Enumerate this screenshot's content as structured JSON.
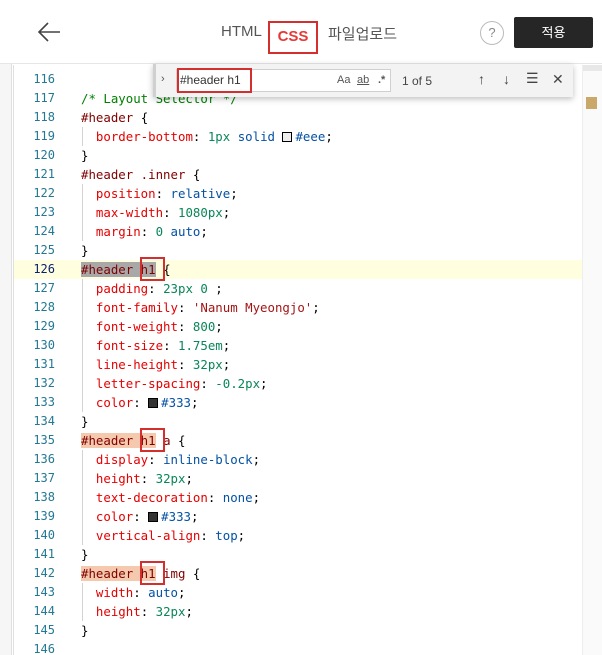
{
  "header": {
    "tabs": [
      {
        "label": "HTML"
      },
      {
        "label": "CSS"
      },
      {
        "label": "파일업로드"
      }
    ],
    "help_label": "?",
    "apply_label": "적용"
  },
  "find": {
    "query": "#header h1",
    "match_case": "Aa",
    "whole_word": "ab",
    "regex": ".*",
    "count": "1 of 5"
  },
  "editor": {
    "current_line": 126,
    "colors": {
      "selector": "#800000",
      "property": "#e50000",
      "number": "#098658",
      "value": "#0451a5",
      "match": "#f5c9ad",
      "annotation": "#d32f2f"
    },
    "lines": [
      {
        "n": "116",
        "text": ""
      },
      {
        "n": "117",
        "text": "/* Layout Selector */"
      },
      {
        "n": "118",
        "text": "#header {"
      },
      {
        "n": "119",
        "text": "  border-bottom: 1px solid #eee;"
      },
      {
        "n": "120",
        "text": "}"
      },
      {
        "n": "121",
        "text": "#header .inner {"
      },
      {
        "n": "122",
        "text": "  position: relative;"
      },
      {
        "n": "123",
        "text": "  max-width: 1080px;"
      },
      {
        "n": "124",
        "text": "  margin: 0 auto;"
      },
      {
        "n": "125",
        "text": "}"
      },
      {
        "n": "126",
        "text": "#header h1 {"
      },
      {
        "n": "127",
        "text": "  padding: 23px 0 ;"
      },
      {
        "n": "128",
        "text": "  font-family: 'Nanum Myeongjo';"
      },
      {
        "n": "129",
        "text": "  font-weight: 800;"
      },
      {
        "n": "130",
        "text": "  font-size: 1.75em;"
      },
      {
        "n": "131",
        "text": "  line-height: 32px;"
      },
      {
        "n": "132",
        "text": "  letter-spacing: -0.2px;"
      },
      {
        "n": "133",
        "text": "  color: #333;"
      },
      {
        "n": "134",
        "text": "}"
      },
      {
        "n": "135",
        "text": "#header h1 a {"
      },
      {
        "n": "136",
        "text": "  display: inline-block;"
      },
      {
        "n": "137",
        "text": "  height: 32px;"
      },
      {
        "n": "138",
        "text": "  text-decoration: none;"
      },
      {
        "n": "139",
        "text": "  color: #333;"
      },
      {
        "n": "140",
        "text": "  vertical-align: top;"
      },
      {
        "n": "141",
        "text": "}"
      },
      {
        "n": "142",
        "text": "#header h1 img {"
      },
      {
        "n": "143",
        "text": "  width: auto;"
      },
      {
        "n": "144",
        "text": "  height: 32px;"
      },
      {
        "n": "145",
        "text": "}"
      },
      {
        "n": "146",
        "text": ""
      }
    ]
  }
}
